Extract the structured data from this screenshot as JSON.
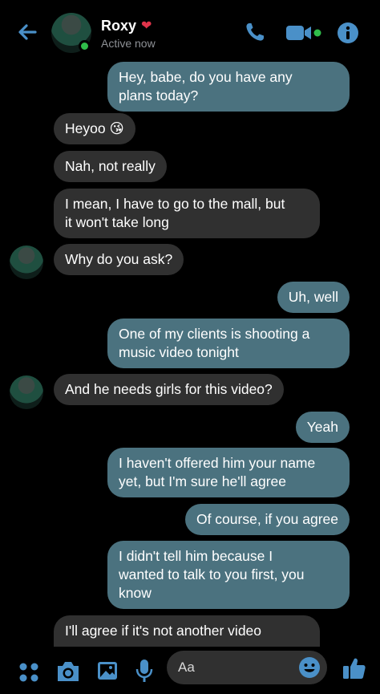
{
  "header": {
    "contact_name": "Roxy",
    "status": "Active now",
    "icons": [
      "back-arrow-icon",
      "heart-emoji-icon",
      "phone-icon",
      "video-camera-icon",
      "info-icon"
    ],
    "accent_color": "#4b727f"
  },
  "messages": [
    {
      "side": "out",
      "lines": [
        "Hey, babe, do you have any",
        "plans today?"
      ]
    },
    {
      "side": "in",
      "lines": [
        "Heyoo 😘"
      ]
    },
    {
      "side": "in",
      "lines": [
        "Nah, not really"
      ]
    },
    {
      "side": "in",
      "lines": [
        "I mean, I have to go to the mall, but",
        "it won't take long"
      ]
    },
    {
      "side": "in",
      "lines": [
        "Why do you ask?"
      ]
    },
    {
      "side": "out",
      "lines": [
        "Uh, well"
      ]
    },
    {
      "side": "out",
      "lines": [
        "One of my clients is shooting a",
        "music video tonight"
      ]
    },
    {
      "side": "in",
      "lines": [
        "And he needs girls for this video?"
      ]
    },
    {
      "side": "out",
      "lines": [
        "Yeah"
      ]
    },
    {
      "side": "out",
      "lines": [
        "I haven't offered him your name",
        "yet, but I'm sure he'll agree"
      ]
    },
    {
      "side": "out",
      "lines": [
        "Of course, if you agree"
      ]
    },
    {
      "side": "out",
      "lines": [
        "I didn't tell him because I",
        "wanted to talk to you first, you",
        "know"
      ]
    },
    {
      "side": "in",
      "lines": [
        "I'll agree if it's not another video"
      ]
    }
  ],
  "composer": {
    "placeholder": "Aa",
    "icons": [
      "apps-icon",
      "camera-icon",
      "gallery-icon",
      "microphone-icon",
      "emoji-icon",
      "thumbs-up-icon"
    ]
  }
}
